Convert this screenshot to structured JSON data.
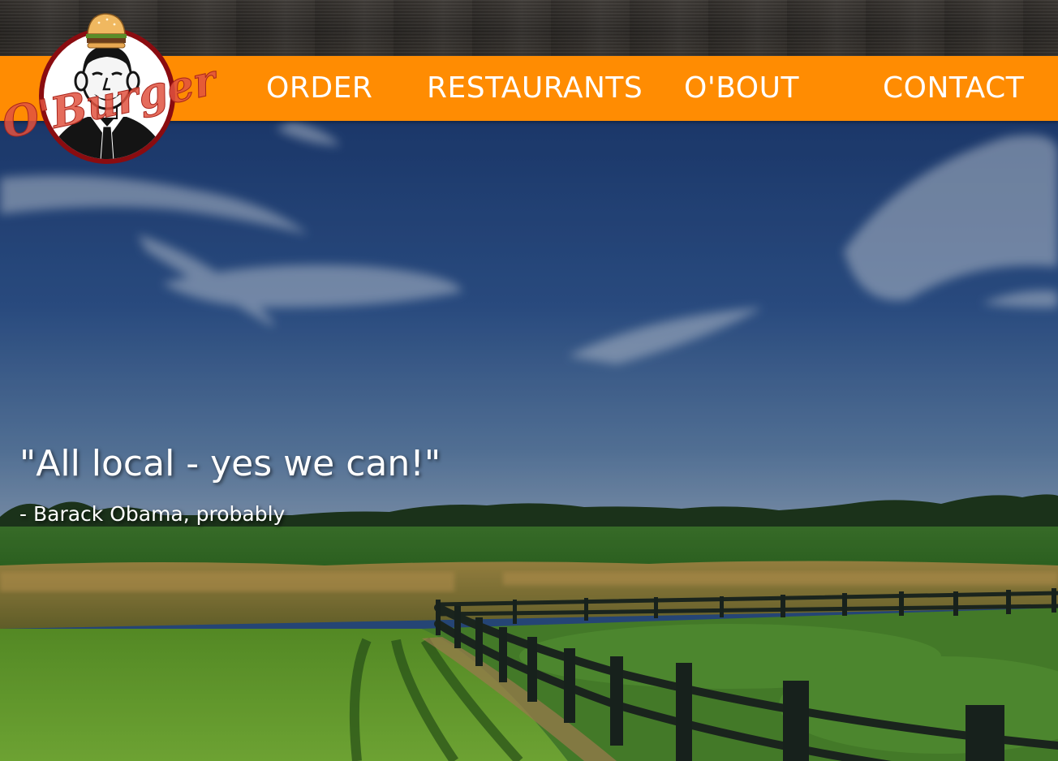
{
  "brand": {
    "logo_text": "O'Burger",
    "colors": {
      "nav": "#ff8c02",
      "logo_ring": "#c0121a",
      "logo_text": "#e0523f"
    }
  },
  "nav": {
    "items": [
      {
        "label": "ORDER"
      },
      {
        "label": "RESTAURANTS"
      },
      {
        "label": "O'BOUT"
      },
      {
        "label": "CONTACT"
      }
    ]
  },
  "hero": {
    "quote": "\"All local - yes we can!\"",
    "attribution": "- Barack Obama, probably"
  }
}
